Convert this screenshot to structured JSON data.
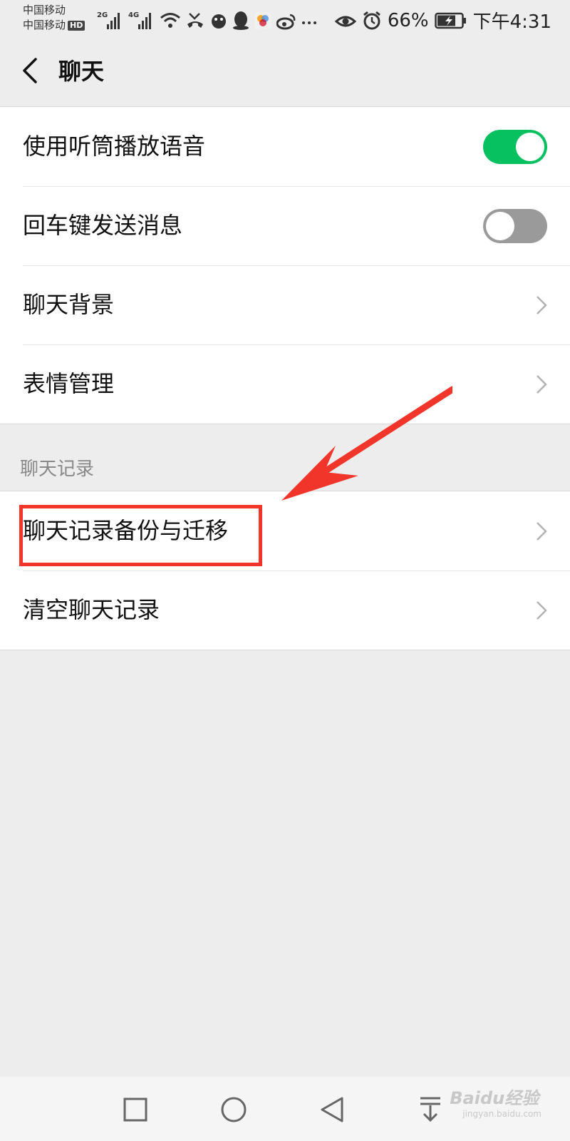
{
  "status_bar": {
    "carrier_1": "中国移动",
    "carrier_2": "中国移动",
    "hd_badge": "HD",
    "net_1": "2G",
    "net_2": "4G",
    "battery": "66%",
    "time": "下午4:31"
  },
  "header": {
    "title": "聊天"
  },
  "settings": {
    "items": [
      {
        "label": "使用听筒播放语音",
        "toggle_on": true
      },
      {
        "label": "回车键发送消息",
        "toggle_on": false
      },
      {
        "label": "聊天背景"
      },
      {
        "label": "表情管理"
      }
    ]
  },
  "chat_history": {
    "section_title": "聊天记录",
    "items": [
      {
        "label": "聊天记录备份与迁移"
      },
      {
        "label": "清空聊天记录"
      }
    ]
  },
  "colors": {
    "toggle_on": "#07c160",
    "toggle_off": "#9a9a9a",
    "annotation": "#f2352a"
  },
  "icons": [
    "back-arrow-icon",
    "chevron-right-icon",
    "square-nav-icon",
    "circle-nav-icon",
    "triangle-back-nav-icon",
    "download-nav-icon"
  ],
  "watermark": "Baidu经验",
  "watermark_url": "jingyan.baidu.com"
}
